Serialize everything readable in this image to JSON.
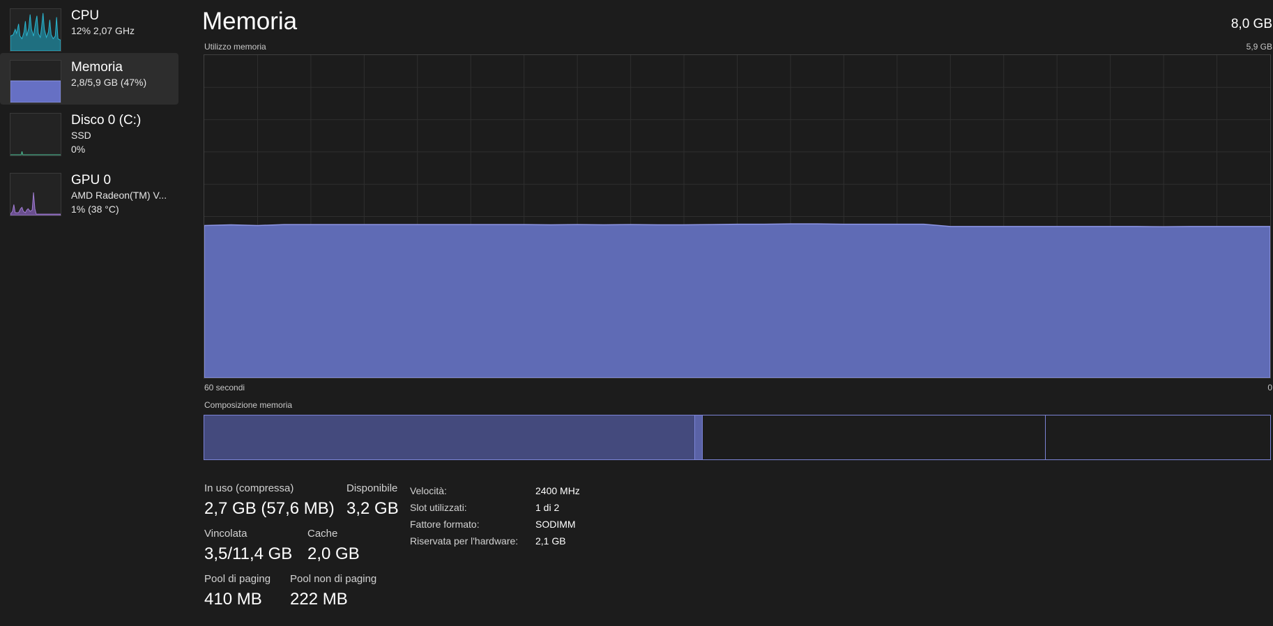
{
  "sidebar": {
    "items": [
      {
        "title": "CPU",
        "line1": "12%  2,07 GHz",
        "line2": "",
        "selected": false,
        "color": "#2bb8d2"
      },
      {
        "title": "Memoria",
        "line1": "2,8/5,9 GB (47%)",
        "line2": "",
        "selected": true,
        "color": "#7b83d8",
        "level": 0.47
      },
      {
        "title": "Disco 0 (C:)",
        "line1": "SSD",
        "line2": "0%",
        "selected": false,
        "color": "#4fc69a"
      },
      {
        "title": "GPU 0",
        "line1": "AMD Radeon(TM) V...",
        "line2": "1%  (38 °C)",
        "selected": false,
        "color": "#a27ed4"
      }
    ]
  },
  "header": {
    "title": "Memoria",
    "total": "8,0 GB"
  },
  "graph": {
    "label": "Utilizzo memoria",
    "max_label": "5,9 GB",
    "x_left_label": "60 secondi",
    "x_right_label": "0",
    "fill_color": "#5f6bb5",
    "line_color": "#8e96e6",
    "usage_fraction_series": [
      0.472,
      0.474,
      0.472,
      0.475,
      0.475,
      0.475,
      0.475,
      0.475,
      0.475,
      0.475,
      0.475,
      0.475,
      0.475,
      0.474,
      0.475,
      0.474,
      0.475,
      0.474,
      0.474,
      0.475,
      0.476,
      0.476,
      0.477,
      0.477,
      0.476,
      0.476,
      0.476,
      0.476,
      0.469,
      0.469,
      0.469,
      0.469,
      0.469,
      0.469,
      0.469,
      0.469,
      0.468,
      0.469,
      0.469,
      0.469,
      0.469
    ]
  },
  "composition": {
    "label": "Composizione memoria",
    "border_color": "#7c84d6",
    "inuse_color": "#444a7d"
  },
  "stats": {
    "in_use_label": "In uso (compressa)",
    "in_use_value": "2,7 GB (57,6 MB)",
    "available_label": "Disponibile",
    "available_value": "3,2 GB",
    "committed_label": "Vincolata",
    "committed_value": "3,5/11,4 GB",
    "cache_label": "Cache",
    "cache_value": "2,0 GB",
    "paged_label": "Pool di paging",
    "paged_value": "410 MB",
    "nonpaged_label": "Pool non di paging",
    "nonpaged_value": "222 MB"
  },
  "info": {
    "speed_key": "Velocità:",
    "speed_val": "2400 MHz",
    "slots_key": "Slot utilizzati:",
    "slots_val": "1 di 2",
    "form_key": "Fattore formato:",
    "form_val": "SODIMM",
    "reserved_key": "Riservata per l'hardware:",
    "reserved_val": "2,1 GB"
  }
}
